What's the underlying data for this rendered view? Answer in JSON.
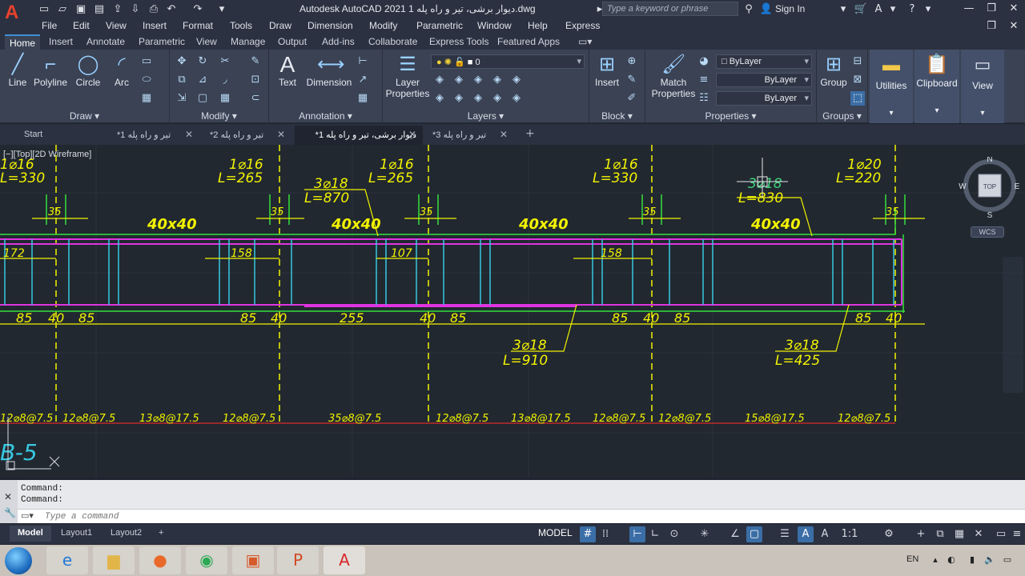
{
  "window": {
    "title": "Autodesk AutoCAD 2021   دیوار برشی، تیر و راه پله 1.dwg",
    "search_placeholder": "Type a keyword or phrase",
    "sign_in": "Sign In"
  },
  "menu": [
    "File",
    "Edit",
    "View",
    "Insert",
    "Format",
    "Tools",
    "Draw",
    "Dimension",
    "Modify",
    "Parametric",
    "Window",
    "Help",
    "Express"
  ],
  "ribbon_tabs": [
    "Home",
    "Insert",
    "Annotate",
    "Parametric",
    "View",
    "Manage",
    "Output",
    "Add-ins",
    "Collaborate",
    "Express Tools",
    "Featured Apps"
  ],
  "active_ribbon_tab": "Home",
  "panels": {
    "draw": {
      "title": "Draw",
      "tools": [
        "Line",
        "Polyline",
        "Circle",
        "Arc"
      ]
    },
    "modify": {
      "title": "Modify"
    },
    "annotation": {
      "title": "Annotation",
      "tools": [
        "Text",
        "Dimension"
      ]
    },
    "layers": {
      "title": "Layers",
      "layer_properties": "Layer Properties",
      "current_layer": "0"
    },
    "block": {
      "title": "Block",
      "insert": "Insert"
    },
    "properties": {
      "title": "Properties",
      "match": "Match Properties",
      "color": "ByLayer",
      "linetype": "ByLayer",
      "lineweight": "ByLayer"
    },
    "groups": {
      "title": "Groups",
      "group": "Group"
    },
    "utilities": "Utilities",
    "clipboard": "Clipboard",
    "view": "View"
  },
  "file_tabs": [
    {
      "label": "Start"
    },
    {
      "label": "تیر و راه پله 1*"
    },
    {
      "label": "تیر و راه پله 2*"
    },
    {
      "label": "دیوار برشی، تیر و راه پله 1*"
    },
    {
      "label": "تیر و راه پله 3*"
    }
  ],
  "viewport_label": "[−][Top][2D Wireframe]",
  "viewcube": {
    "north": "N",
    "south": "S",
    "east": "E",
    "west": "W",
    "top": "TOP",
    "wcs": "WCS"
  },
  "drawing": {
    "top_bars": [
      {
        "spec": "1⌀16",
        "len": "L=330"
      },
      {
        "spec": "1⌀16",
        "len": "L=265"
      },
      {
        "spec": "3⌀18",
        "len": "L=870"
      },
      {
        "spec": "1⌀16",
        "len": "L=265"
      },
      {
        "spec": "1⌀16",
        "len": "L=330"
      },
      {
        "spec": "3⌀18",
        "len": "L=830"
      },
      {
        "spec": "1⌀20",
        "len": "L=220"
      }
    ],
    "columns_label": "35",
    "beam_sizes": [
      "40x40",
      "40x40",
      "40x40",
      "40x40"
    ],
    "inner_dims": [
      "172",
      "158",
      "107",
      "158"
    ],
    "bottom_dims": [
      "85",
      "40",
      "85",
      "85",
      "40",
      "255",
      "40",
      "85",
      "85",
      "40",
      "85",
      "85",
      "40"
    ],
    "bottom_bars": [
      {
        "spec": "3⌀18",
        "len": "L=910"
      },
      {
        "spec": "3⌀18",
        "len": "L=425"
      }
    ],
    "stirrups": [
      "12⌀8@7.5",
      "12⌀8@7.5",
      "13⌀8@17.5",
      "12⌀8@7.5",
      "35⌀8@7.5",
      "12⌀8@7.5",
      "13⌀8@17.5",
      "12⌀8@7.5",
      "12⌀8@7.5",
      "15⌀8@17.5",
      "12⌀8@7.5"
    ],
    "beam_name": "B-5"
  },
  "command": {
    "history": [
      "Command:",
      "Command:"
    ],
    "placeholder": "Type a command"
  },
  "layout_tabs": [
    "Model",
    "Layout1",
    "Layout2"
  ],
  "status": {
    "model": "MODEL",
    "scale": "1:1"
  },
  "taskbar": {
    "lang": "EN"
  },
  "colors": {
    "accent": "#3d8fd8",
    "dim_yellow": "#f2f200",
    "dim_green": "#35e03a",
    "beam_magenta": "#e033e0",
    "stirrup_cyan": "#37c8e0",
    "rebar_red": "#e02a2a"
  }
}
